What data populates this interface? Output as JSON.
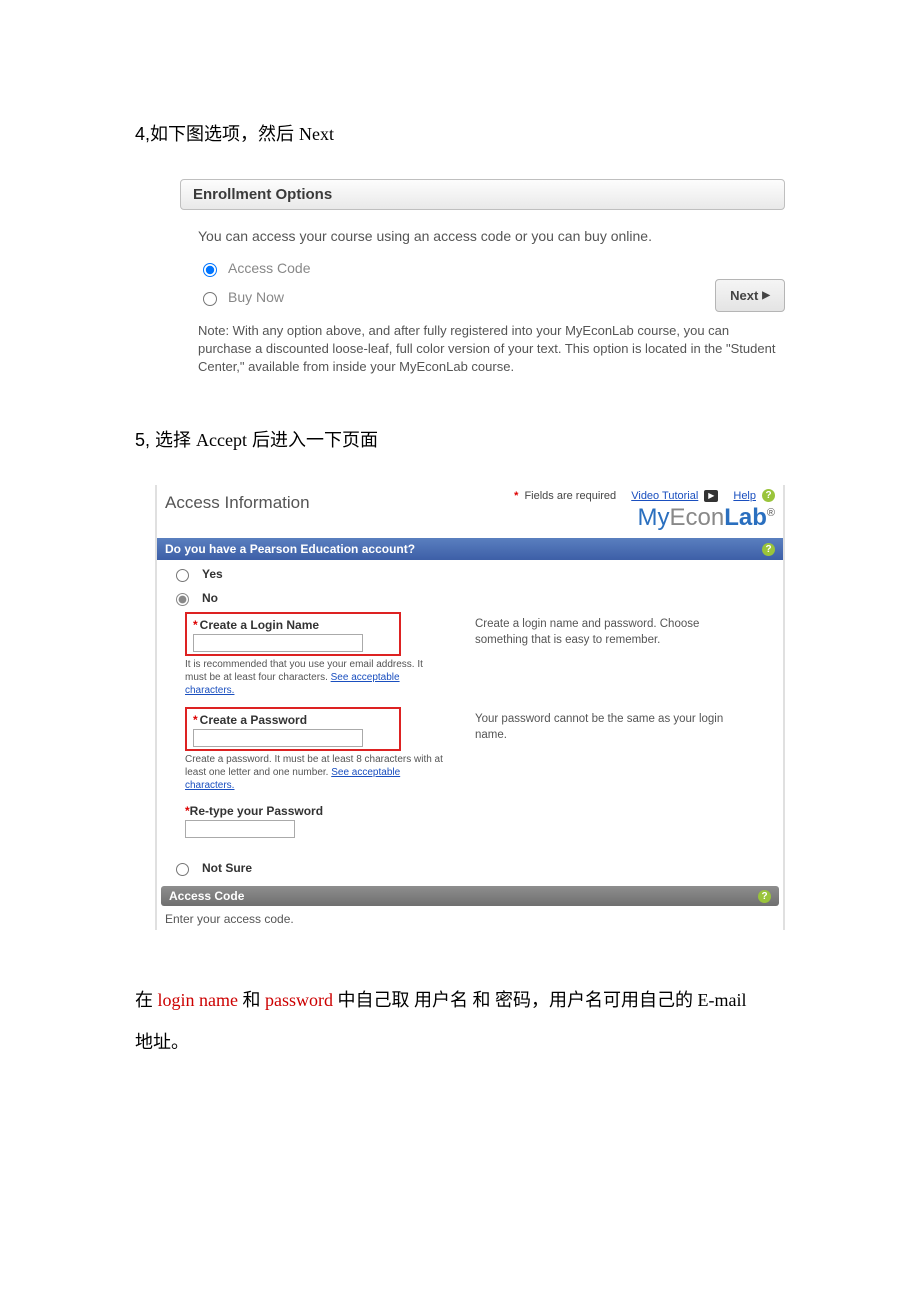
{
  "step4": {
    "text_prefix": "4,如下图选项，然后 ",
    "text_next": "Next"
  },
  "enroll": {
    "header": "Enrollment Options",
    "intro": "You can access your course using an access code or you can buy online.",
    "option_access": "Access Code",
    "option_buy": "Buy Now",
    "next_label": "Next",
    "note": "Note: With any option above, and after fully registered into your MyEconLab course, you can purchase a discounted loose-leaf, full color version of your text. This option is located in the \"Student Center,\" available from inside your MyEconLab course."
  },
  "step5": {
    "text_prefix": "5,  选择 ",
    "text_accept": "Accept",
    "text_suffix": "  后进入一下页面"
  },
  "access": {
    "title": "Access Information",
    "required_note": "Fields are required",
    "video_tutorial": "Video Tutorial",
    "help": "Help",
    "brand_my": "My",
    "brand_econ": "Econ",
    "brand_lab": "Lab",
    "brand_reg": "®",
    "question_bar": "Do you have a Pearson Education account?",
    "yes": "Yes",
    "no": "No",
    "not_sure": "Not Sure",
    "login": {
      "label": "Create a Login Name",
      "hint_prefix": "It is recommended that you use your email address. It must be at least four characters. ",
      "hint_link": "See acceptable characters.",
      "desc": "Create a login name and password. Choose something that is easy to remember."
    },
    "password": {
      "label": "Create a Password",
      "hint_prefix": "Create a password. It must be at least 8 characters with at least one letter and one number. ",
      "hint_link": "See acceptable characters.",
      "desc": "Your password cannot be the same as your login name."
    },
    "retype_label": "Re-type your Password",
    "code_bar": "Access Code",
    "code_note": "Enter your access code."
  },
  "bottom": {
    "p1_prefix": "在 ",
    "p1_login": "login name",
    "p1_mid1": " 和 ",
    "p1_password": "password",
    "p1_mid2": " 中自己取 用户名 和 密码，用户名可用自己的 ",
    "p1_email": "E-mail",
    "p2": "地址。"
  }
}
